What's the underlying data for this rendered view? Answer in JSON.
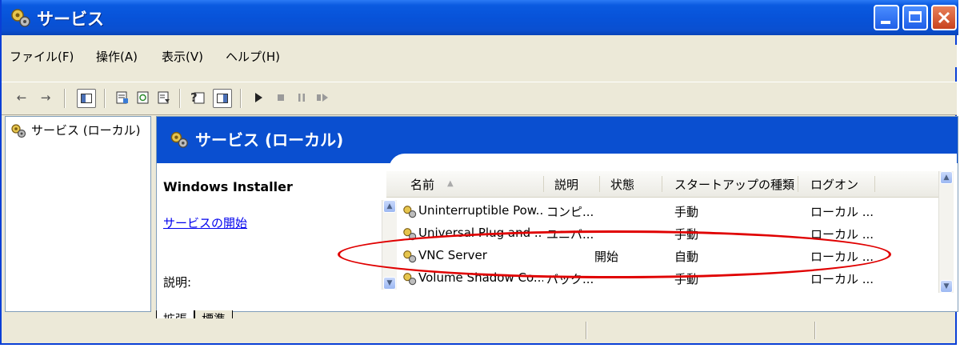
{
  "window": {
    "title": "サービス"
  },
  "menu": [
    "ファイル(F)",
    "操作(A)",
    "表示(V)",
    "ヘルプ(H)"
  ],
  "tree": {
    "root_label": "サービス (ローカル)"
  },
  "panel": {
    "header": "サービス (ローカル)",
    "service_name": "Windows Installer",
    "start_link": "サービスの開始",
    "description_label": "説明:"
  },
  "list": {
    "columns": [
      "名前",
      "説明",
      "状態",
      "スタートアップの種類",
      "ログオン"
    ],
    "rows": [
      {
        "name": "Uninterruptible Pow...",
        "desc": "コンピ...",
        "status": "",
        "startup": "手動",
        "logon": "ローカル ..."
      },
      {
        "name": "Universal Plug and ...",
        "desc": "ユニバ...",
        "status": "",
        "startup": "手動",
        "logon": "ローカル ..."
      },
      {
        "name": "VNC Server",
        "desc": "",
        "status": "開始",
        "startup": "自動",
        "logon": "ローカル ..."
      },
      {
        "name": "Volume Shadow Co...",
        "desc": "バック...",
        "status": "",
        "startup": "手動",
        "logon": "ローカル ..."
      }
    ]
  },
  "tabs": [
    "拡張",
    "標準"
  ],
  "icons": {
    "app": "gear-service-icon",
    "back": "back-arrow-icon",
    "forward": "forward-arrow-icon"
  },
  "colors": {
    "titlebar": "#0a4fd0",
    "header_band": "#0a4fd0",
    "highlight_oval": "#e00000",
    "link": "#0000ee"
  }
}
